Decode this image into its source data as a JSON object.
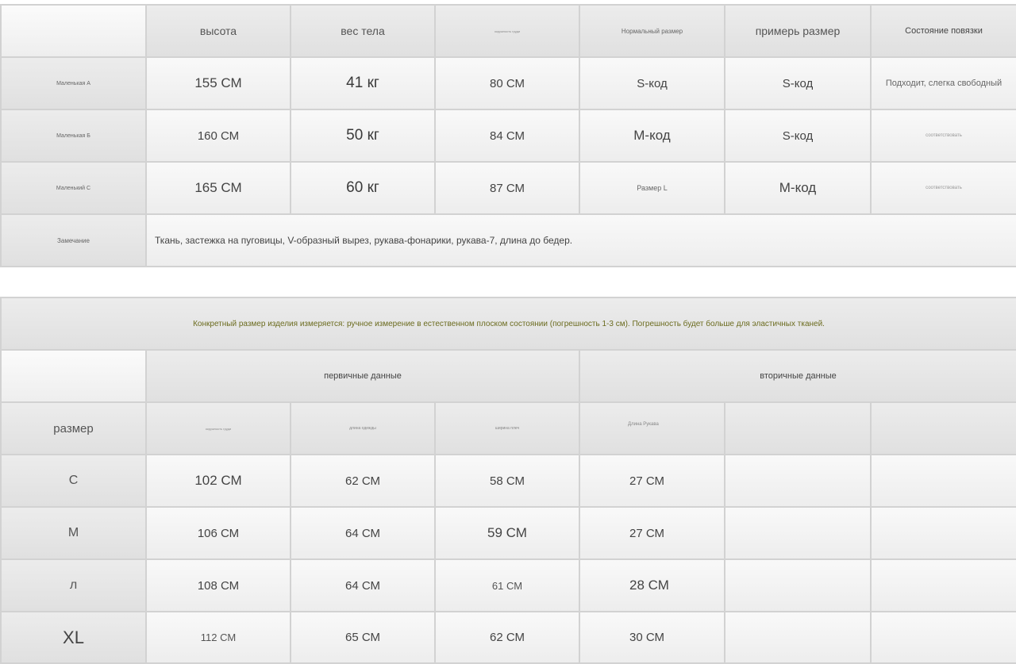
{
  "table1": {
    "headers": [
      "",
      "высота",
      "вес тела",
      "окружность груди",
      "Нормальный размер",
      "примерь размер",
      "Состояние повязки"
    ],
    "rows": [
      {
        "label": "Маленькая A",
        "values": [
          "155 СМ",
          "41 кг",
          "80 СМ",
          "S-код",
          "S-код",
          "Подходит, слегка свободный"
        ]
      },
      {
        "label": "Маленькая Б",
        "values": [
          "160 СМ",
          "50 кг",
          "84 СМ",
          "M-код",
          "S-код",
          "соответствовать"
        ]
      },
      {
        "label": "Маленький С",
        "values": [
          "165 СМ",
          "60 кг",
          "87 СМ",
          "Размер L",
          "M-код",
          "соответствовать"
        ]
      }
    ],
    "note_label": "Замечание",
    "note_text": "Ткань, застежка на пуговицы, V-образный вырез, рукава-фонарики, рукава-7, длина до бедер."
  },
  "table2": {
    "banner": "Конкретный размер изделия измеряется: ручное измерение в естественном плоском состоянии (погрешность 1-3 см). Погрешность будет больше для эластичных тканей.",
    "group_primary": "первичные данные",
    "group_secondary": "вторичные данные",
    "size_label": "размер",
    "columns": [
      "окружность груди",
      "длина одежды",
      "ширина плеч",
      "Длина Рукава",
      "",
      ""
    ],
    "rows": [
      {
        "size": "С",
        "values": [
          "102 СМ",
          "62 СМ",
          "58 СМ",
          "27 СМ",
          "",
          ""
        ]
      },
      {
        "size": "M",
        "values": [
          "106 СМ",
          "64 СМ",
          "59 СМ",
          "27 СМ",
          "",
          ""
        ]
      },
      {
        "size": "л",
        "values": [
          "108 СМ",
          "64 СМ",
          "61 СМ",
          "28 СМ",
          "",
          ""
        ]
      },
      {
        "size": "XL",
        "values": [
          "112 СМ",
          "65 СМ",
          "62 СМ",
          "30 СМ",
          "",
          ""
        ]
      }
    ]
  }
}
